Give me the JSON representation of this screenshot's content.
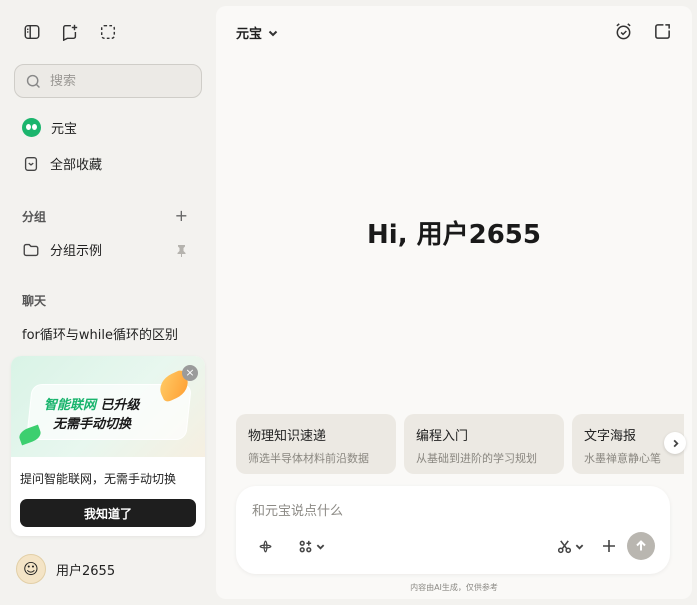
{
  "sidebar": {
    "search": {
      "placeholder": "搜索"
    },
    "nav": [
      {
        "label": "元宝",
        "icon": "yuanbao-logo"
      },
      {
        "label": "全部收藏",
        "icon": "bookmark-icon"
      }
    ],
    "groups_title": "分组",
    "groups": [
      {
        "label": "分组示例",
        "icon": "folder-icon"
      }
    ],
    "chats_title": "聊天",
    "chats": [
      {
        "label": "for循环与while循环的区别"
      }
    ],
    "promo": {
      "banner_green": "智能联网",
      "banner_rest": " 已升级",
      "banner_line2": "无需手动切换",
      "close": "×",
      "text": "提问智能联网，无需手动切换",
      "button": "我知道了"
    },
    "user": {
      "name": "用户2655",
      "avatar": "avatar"
    }
  },
  "main": {
    "model": "元宝",
    "greeting": "Hi, 用户2655",
    "cards": [
      {
        "title": "物理知识速递",
        "subtitle": "筛选半导体材料前沿数据"
      },
      {
        "title": "编程入门",
        "subtitle": "从基础到进阶的学习规划"
      },
      {
        "title": "文字海报",
        "subtitle": "水墨禅意静心笔"
      }
    ],
    "input": {
      "placeholder": "和元宝说点什么"
    },
    "footer_note": "内容由AI生成，仅供参考"
  },
  "colors": {
    "accent_green": "#19b46d",
    "send_disabled": "#b9b6b0",
    "button_dark": "#1e1e1e"
  }
}
